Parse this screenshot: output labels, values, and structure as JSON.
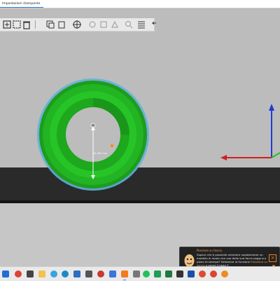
{
  "window": {
    "tab_label": "Impostazioni stampante"
  },
  "toolbar": {
    "tools": [
      "add-icon",
      "delete-icon",
      "delete-all-icon",
      "arrange-icon",
      "copy-icon",
      "paste-icon",
      "add-instance-icon",
      "remove-instance-icon",
      "split-objects-icon",
      "split-parts-icon",
      "variable-layer-height-icon",
      "search-icon",
      "layers-icon",
      "undo-icon",
      "redo-icon"
    ]
  },
  "viewport": {
    "dimension_label": "35,000 mm",
    "object_color": "#22b422",
    "bed_color": "#2a2a2a",
    "axes": {
      "x_color": "#d02020",
      "y_color": "#20c020",
      "z_color": "#1e3cd2"
    }
  },
  "notification": {
    "title": "Pensiere su faccia",
    "body": "Sapevi che è possibile orientare rapidamente un modello in modo che una delle sue facce poggi sul piano di stampa? Seleziona la funzione",
    "link": "Posiziona su faccia",
    "tail": "o premi il tasto F.",
    "accent_color": "#f08020"
  },
  "taskbar": {
    "apps": [
      "start-icon",
      "search-icon",
      "chrome-icon",
      "task-view-icon",
      "explorer-icon",
      "telegram-icon",
      "edge-icon",
      "store-icon",
      "camera-icon",
      "mail-icon",
      "photos-icon",
      "prusaslicer-icon",
      "video-icon",
      "whatsapp-icon",
      "word-icon",
      "excel-icon",
      "terminal-icon",
      "app-icon",
      "outlook-icon",
      "chrome-profile-icon",
      "firefox-icon"
    ]
  }
}
